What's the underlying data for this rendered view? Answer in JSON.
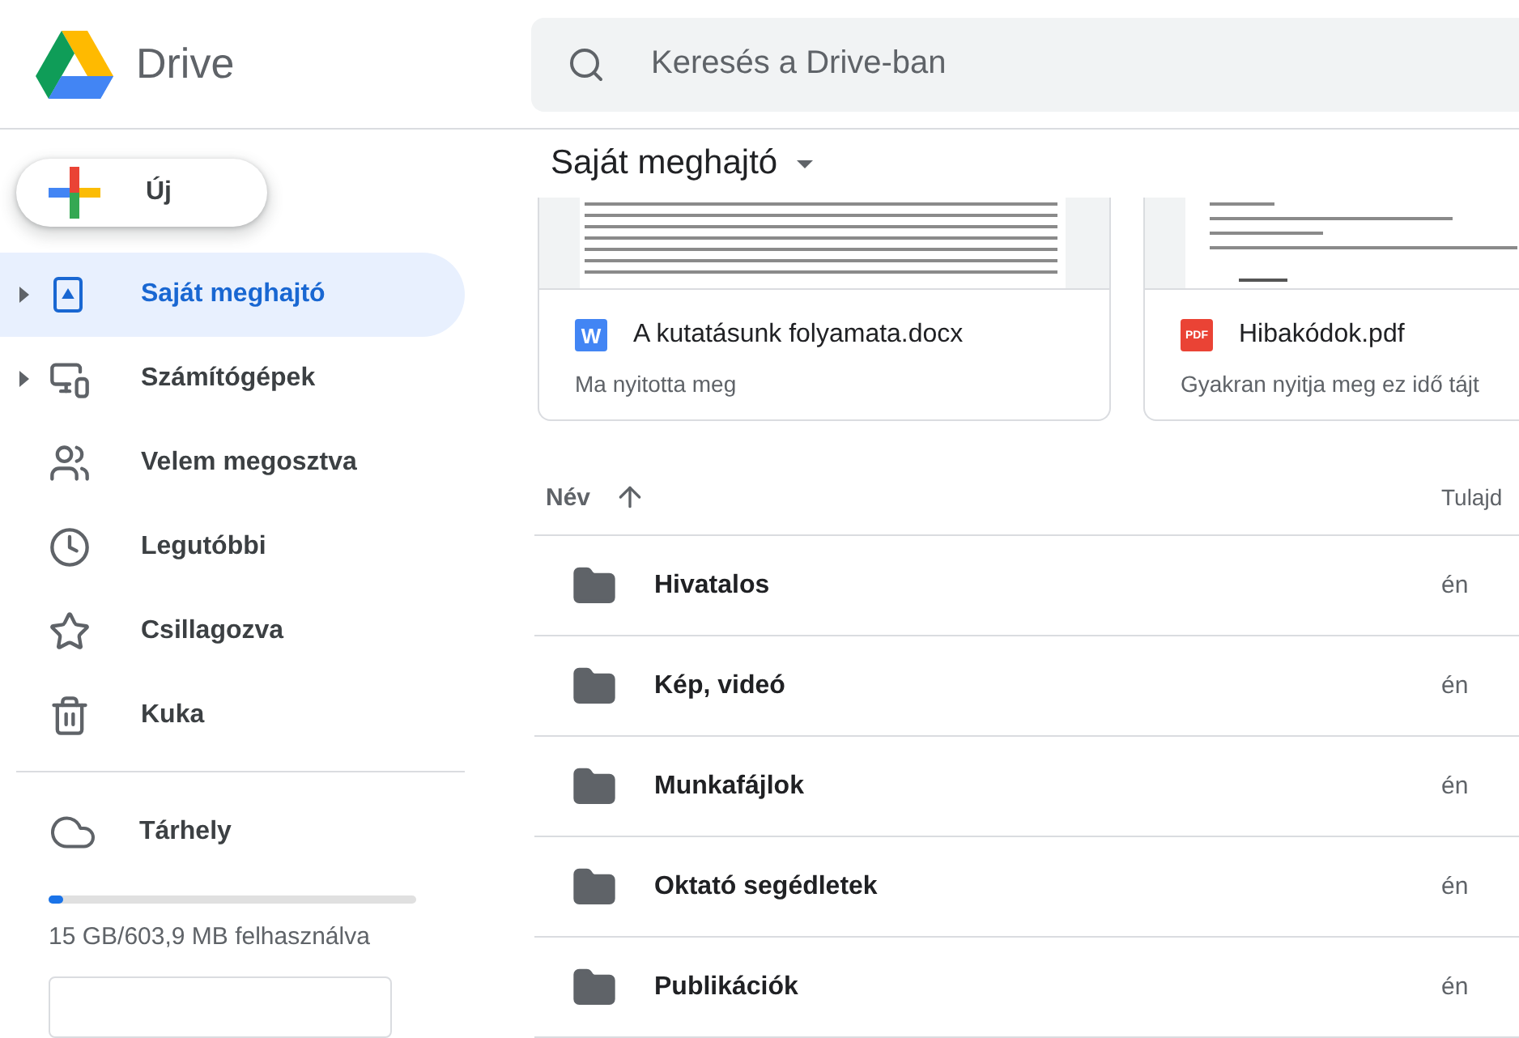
{
  "app": {
    "name": "Drive"
  },
  "search": {
    "placeholder": "Keresés a Drive-ban"
  },
  "new_button": {
    "label": "Új"
  },
  "sidebar": {
    "items": [
      {
        "kind": "drive",
        "label": "Saját meghajtó",
        "selected": true,
        "expandable": true
      },
      {
        "kind": "computers",
        "label": "Számítógépek",
        "selected": false,
        "expandable": true
      },
      {
        "kind": "shared",
        "label": "Velem megosztva",
        "selected": false,
        "expandable": false
      },
      {
        "kind": "recent",
        "label": "Legutóbbi",
        "selected": false,
        "expandable": false
      },
      {
        "kind": "starred",
        "label": "Csillagozva",
        "selected": false,
        "expandable": false
      },
      {
        "kind": "trash",
        "label": "Kuka",
        "selected": false,
        "expandable": false
      }
    ]
  },
  "storage": {
    "label": "Tárhely",
    "level": 0.04,
    "usage": "15 GB/603,9 MB felhasználva"
  },
  "main": {
    "title": "Saját meghajtó"
  },
  "suggested": [
    {
      "kind": "word",
      "badge": "W",
      "name": "A kutatásunk folyamata.docx",
      "reason": "Ma nyitotta meg"
    },
    {
      "kind": "pdf",
      "badge": "PDF",
      "name": "Hibakódok.pdf",
      "reason": "Gyakran nyitja meg ez idő tájt"
    }
  ],
  "table": {
    "columns": [
      "Név",
      "Tulajd"
    ],
    "rows": [
      {
        "name": "Hivatalos",
        "owner": "én"
      },
      {
        "name": "Kép, videó",
        "owner": "én"
      },
      {
        "name": "Munkafájlok",
        "owner": "én"
      },
      {
        "name": "Oktató segédletek",
        "owner": "én"
      },
      {
        "name": "Publikációk",
        "owner": "én"
      }
    ]
  }
}
